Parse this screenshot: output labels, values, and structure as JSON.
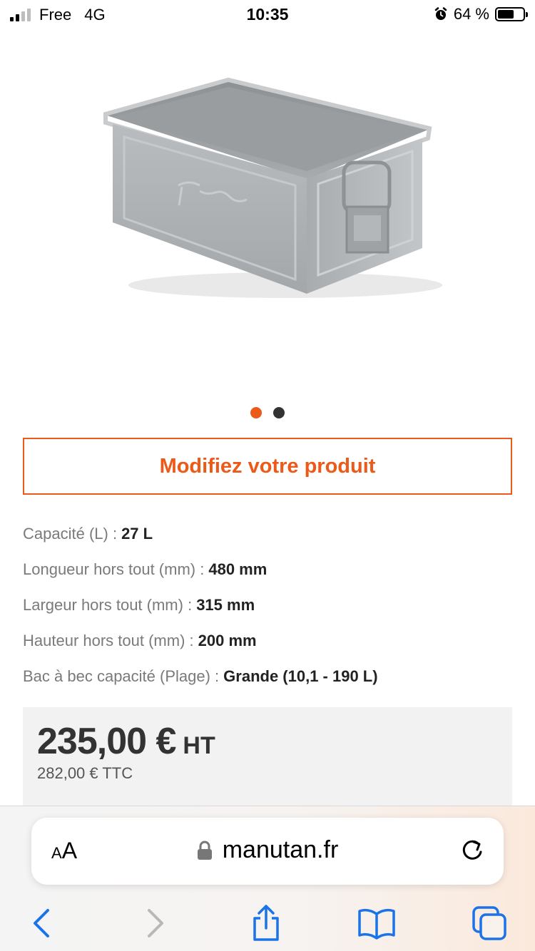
{
  "status_bar": {
    "carrier": "Free",
    "network": "4G",
    "time": "10:35",
    "battery": "64 %",
    "battery_level": 0.64
  },
  "product": {
    "image_icon": "metal-storage-bin-image",
    "carousel_total": 2,
    "carousel_active": 1,
    "modify_button": "Modifiez votre produit"
  },
  "specs": [
    {
      "label": "Capacité (L) :",
      "value": "27 L"
    },
    {
      "label": "Longueur hors tout (mm) :",
      "value": "480 mm"
    },
    {
      "label": "Largeur hors tout (mm) :",
      "value": "315 mm"
    },
    {
      "label": "Hauteur hors tout (mm) :",
      "value": "200 mm"
    },
    {
      "label": "Bac à bec capacité (Plage) :",
      "value": "Grande (10,1 - 190 L)"
    }
  ],
  "price": {
    "ht_amount": "235,00 €",
    "ht_suffix": "HT",
    "ttc": "282,00 € TTC"
  },
  "browser": {
    "aa_small": "A",
    "aa_large": "A",
    "url": "manutan.fr",
    "icons": [
      "back-icon",
      "forward-icon",
      "share-icon",
      "bookmarks-icon",
      "tabs-icon",
      "lock-icon",
      "reload-icon"
    ]
  },
  "colors": {
    "accent": "#ec5a1a",
    "ios_blue": "#1a73e8"
  }
}
